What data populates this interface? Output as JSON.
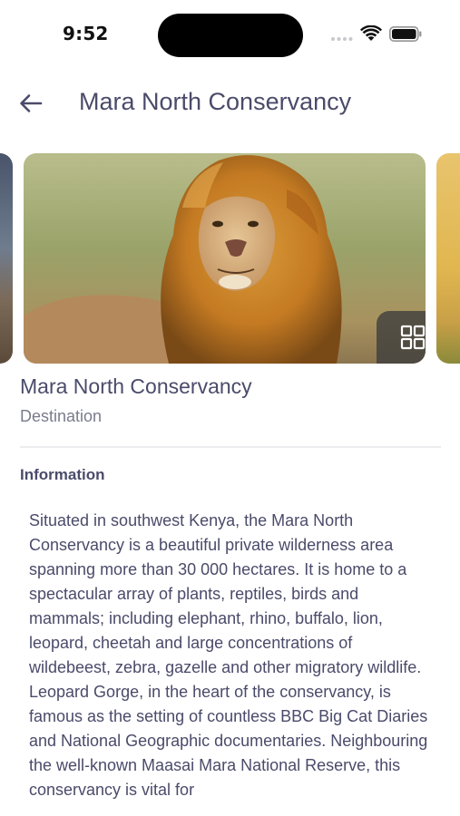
{
  "status_bar": {
    "time": "9:52"
  },
  "header": {
    "title": "Mara North Conservancy",
    "back_icon": "arrow-left-icon"
  },
  "gallery": {
    "button_icon": "grid-icon",
    "image_subject": "lion"
  },
  "place": {
    "title": "Mara North Conservancy",
    "subtitle": "Destination"
  },
  "information": {
    "heading": "Information",
    "body": "Situated in southwest Kenya, the Mara North Conservancy is a beautiful private wilderness area spanning more than 30 000 hectares. It is home to a spectacular array of plants, reptiles, birds and mammals; including elephant, rhino, buffalo, lion, leopard, cheetah and large concentrations of wildebeest, zebra, gazelle and other migratory wildlife. Leopard Gorge, in the heart of the conservancy, is famous as the setting of countless BBC Big Cat Diaries and National Geographic documentaries. Neighbouring the well-known Maasai Mara National Reserve, this conservancy is vital for"
  },
  "colors": {
    "text_primary": "#4a4b6a",
    "text_secondary": "#7a7b8c",
    "divider": "#ececef"
  }
}
